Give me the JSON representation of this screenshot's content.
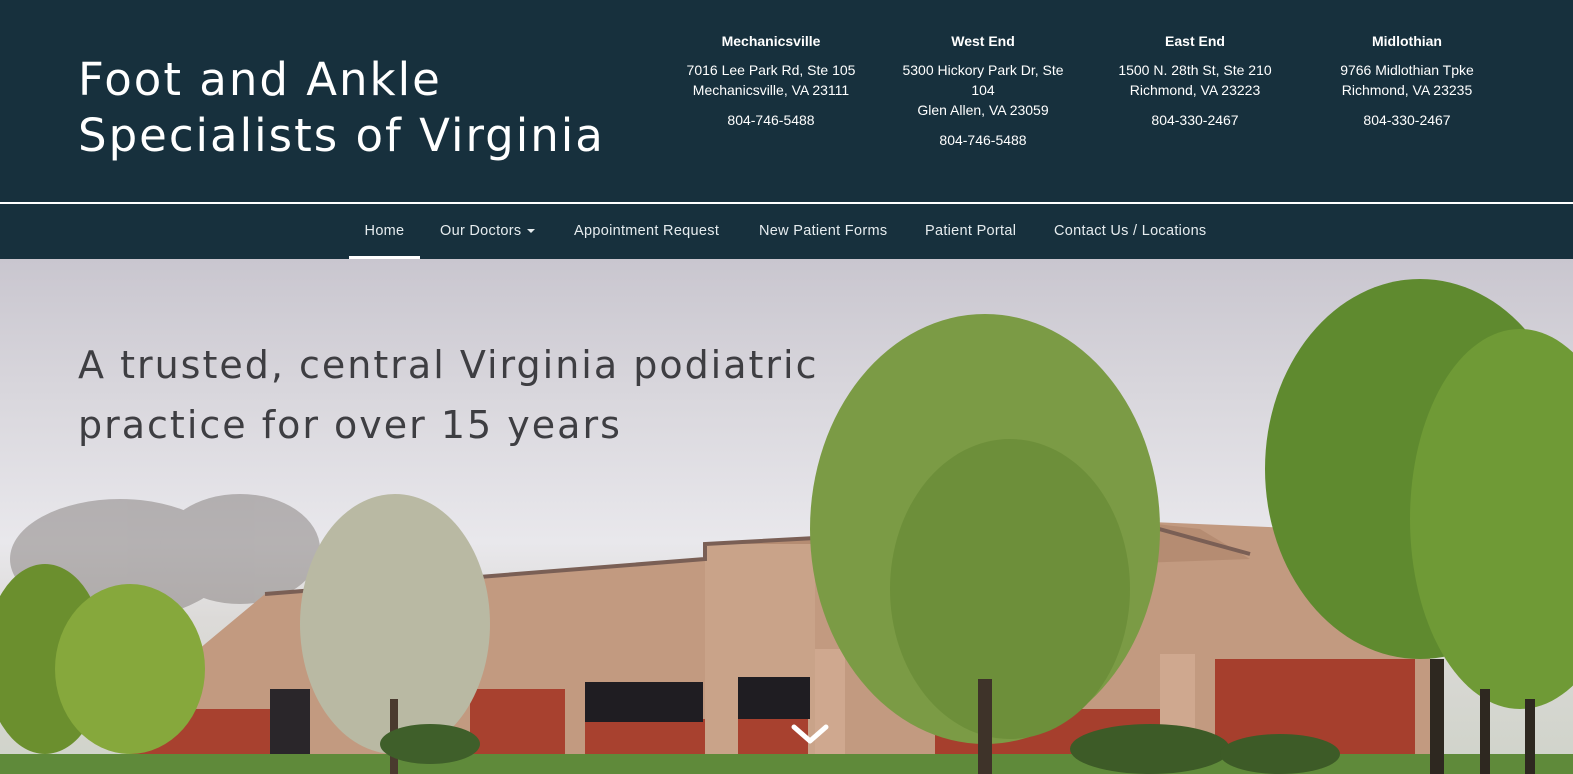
{
  "site": {
    "title": "Foot and Ankle Specialists of Virginia"
  },
  "locations": [
    {
      "name": "Mechanicsville",
      "lines": [
        "7016 Lee Park Rd, Ste 105",
        "Mechanicsville, VA 23111"
      ],
      "phone": "804-746-5488"
    },
    {
      "name": "West End",
      "lines": [
        "5300 Hickory Park Dr, Ste",
        "104",
        "Glen Allen, VA 23059"
      ],
      "phone": "804-746-5488"
    },
    {
      "name": "East End",
      "lines": [
        "1500 N. 28th St, Ste 210",
        "Richmond, VA 23223"
      ],
      "phone": "804-330-2467"
    },
    {
      "name": "Midlothian",
      "lines": [
        "9766 Midlothian Tpke",
        "Richmond, VA 23235"
      ],
      "phone": "804-330-2467"
    }
  ],
  "nav": {
    "items": [
      {
        "label": "Home",
        "active": true
      },
      {
        "label": "Our Doctors",
        "dropdown": true
      },
      {
        "label": "Appointment Request"
      },
      {
        "label": "New Patient Forms"
      },
      {
        "label": "Patient Portal"
      },
      {
        "label": "Contact Us / Locations"
      }
    ]
  },
  "hero": {
    "tagline": "A trusted, central Virginia podiatric practice for over 15 years",
    "scroll_icon": "chevron-down-icon"
  },
  "colors": {
    "header_bg": "#17303d",
    "text_light": "#ffffff",
    "tagline": "#3e3e42"
  }
}
